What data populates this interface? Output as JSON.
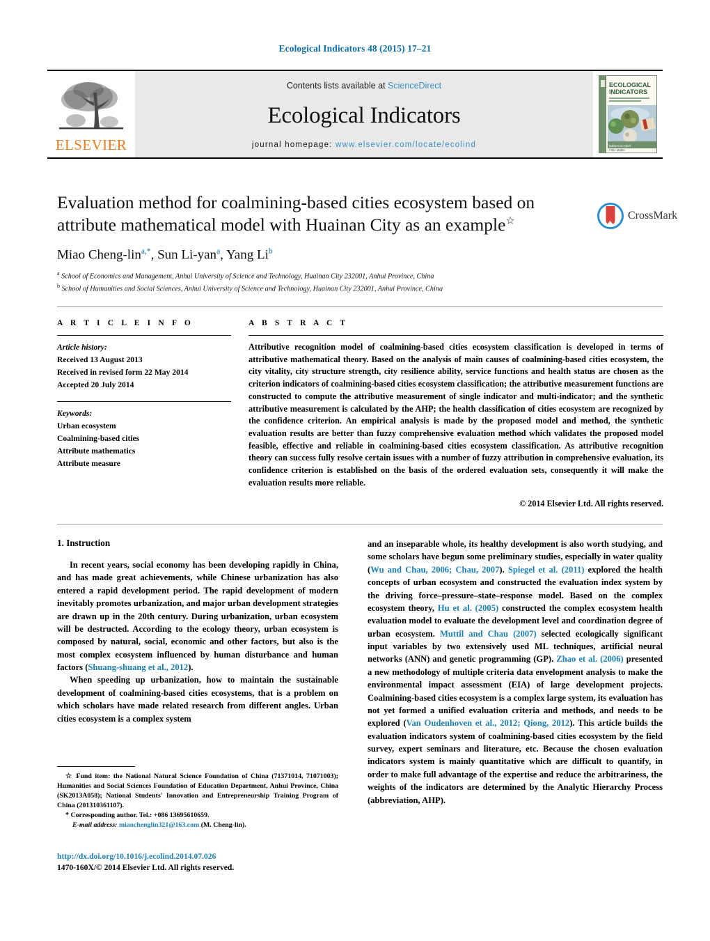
{
  "running_head": "Ecological Indicators 48 (2015) 17–21",
  "masthead": {
    "contents_prefix": "Contents lists available at ",
    "sciencedirect": "ScienceDirect",
    "journal_title": "Ecological Indicators",
    "homepage_prefix": "journal homepage: ",
    "homepage_url": "www.elsevier.com/locate/ecolind",
    "publisher": "ELSEVIER",
    "publisher_color": "#ef7d1a",
    "link_color": "#3a8fc4",
    "cover_title_line1": "ECOLOGICAL",
    "cover_title_line2": "INDICATORS"
  },
  "article": {
    "title": "Evaluation method for coalmining-based cities ecosystem based on attribute mathematical model with Huainan City as an example",
    "title_footnote_marker": "☆",
    "authors": [
      {
        "name": "Miao Cheng-lin",
        "sup": "a,*"
      },
      {
        "name": "Sun Li-yan",
        "sup": "a"
      },
      {
        "name": "Yang Li",
        "sup": "b"
      }
    ],
    "affiliations": [
      {
        "marker": "a",
        "text": "School of Economics and Management, Anhui University of Science and Technology, Huainan City 232001, Anhui Province, China"
      },
      {
        "marker": "b",
        "text": "School of Humanities and Social Sciences, Anhui University of Science and Technology, Huainan City 232001, Anhui Province, China"
      }
    ],
    "crossmark_label": "CrossMark"
  },
  "article_info": {
    "heading": "A R T I C L E   I N F O",
    "history_label": "Article history:",
    "history": [
      "Received 13 August 2013",
      "Received in revised form 22 May 2014",
      "Accepted 20 July 2014"
    ],
    "keywords_label": "Keywords:",
    "keywords": [
      "Urban ecosystem",
      "Coalmining-based cities",
      "Attribute mathematics",
      "Attribute measure"
    ]
  },
  "abstract": {
    "heading": "A B S T R A C T",
    "text": "Attributive recognition model of coalmining-based cities ecosystem classification is developed in terms of attributive mathematical theory. Based on the analysis of main causes of coalmining-based cities ecosystem, the city vitality, city structure strength, city resilience ability, service functions and health status are chosen as the criterion indicators of coalmining-based cities ecosystem classification; the attributive measurement functions are constructed to compute the attributive measurement of single indicator and multi-indicator; and the synthetic attributive measurement is calculated by the AHP; the health classification of cities ecosystem are recognized by the confidence criterion. An empirical analysis is made by the proposed model and method, the synthetic evaluation results are better than fuzzy comprehensive evaluation method which validates the proposed model feasible, effective and reliable in coalmining-based cities ecosystem classification. As attributive recognition theory can success fully resolve certain issues with a number of fuzzy attribution in comprehensive evaluation, its confidence criterion is established on the basis of the ordered evaluation sets, consequently it will make the evaluation results more reliable.",
    "copyright": "© 2014 Elsevier Ltd. All rights reserved."
  },
  "body": {
    "section_number_title": "1.  Instruction",
    "left_paragraphs": [
      "In recent years, social economy has been developing rapidly in China, and has made great achievements, while Chinese urbanization has also entered a rapid development period. The rapid development of modern inevitably promotes urbanization, and major urban development strategies are drawn up in the 20th century. During urbanization, urban ecosystem will be destructed. According to the ecology theory, urban ecosystem is composed by natural, social, economic and other factors, but also is the most complex ecosystem influenced by human disturbance and human factors (|Shuang-shuang et al., 2012|).",
      "When speeding up urbanization, how to maintain the sustainable development of coalmining-based cities ecosystems, that is a problem on which scholars have made related research from different angles. Urban cities ecosystem is a complex system"
    ],
    "right_paragraphs": [
      "and an inseparable whole, its healthy development is also worth studying, and some scholars have begun some preliminary studies, especially in water quality (|Wu and Chau, 2006; Chau, 2007|). |Spiegel et al. (2011)| explored the health concepts of urban ecosystem and constructed the evaluation index system by the driving force–pressure–state–response model. Based on the complex ecosystem theory, |Hu et al. (2005)| constructed the complex ecosystem health evaluation model to evaluate the development level and coordination degree of urban ecosystem. |Muttil and Chau (2007)| selected ecologically significant input variables by two extensively used ML techniques, artificial neural networks (ANN) and genetic programming (GP). |Zhao et al. (2006)| presented a new methodology of multiple criteria data envelopment analysis to make the environmental impact assessment (EIA) of large development projects. Coalmining-based cities ecosystem is a complex large system, its evaluation has not yet formed a unified evaluation criteria and methods, and needs to be explored (|Van Oudenhoven et al., 2012; Qiong, 2012|). This article builds the evaluation indicators system of coalmining-based cities ecosystem by the field survey, expert seminars and literature, etc. Because the chosen evaluation indicators system is mainly quantitative which are difficult to quantify, in order to make full advantage of the expertise and reduce the arbitrariness, the weights of the indicators are determined by the Analytic Hierarchy Process (abbreviation, AHP)."
    ]
  },
  "footnotes": {
    "fund_marker": "☆",
    "fund_label": "Fund item:",
    "fund_text": " the National Natural Science Foundation of China (71371014, 71071003); Humanities and Social Sciences Foundation of Education Department, Anhui Province, China (SK2013A058); National Students' Innovation and Entrepreneurship Training Program of China (201310361107).",
    "corresponding_marker": "*",
    "corresponding_text": "Corresponding author. Tel.: +086 13695610659.",
    "email_label": "E-mail address:",
    "email": "miaochenglin321@163.com",
    "email_suffix": " (M. Cheng-lin)."
  },
  "bottom": {
    "doi": "http://dx.doi.org/10.1016/j.ecolind.2014.07.026",
    "issn_line": "1470-160X/© 2014 Elsevier Ltd. All rights reserved."
  }
}
